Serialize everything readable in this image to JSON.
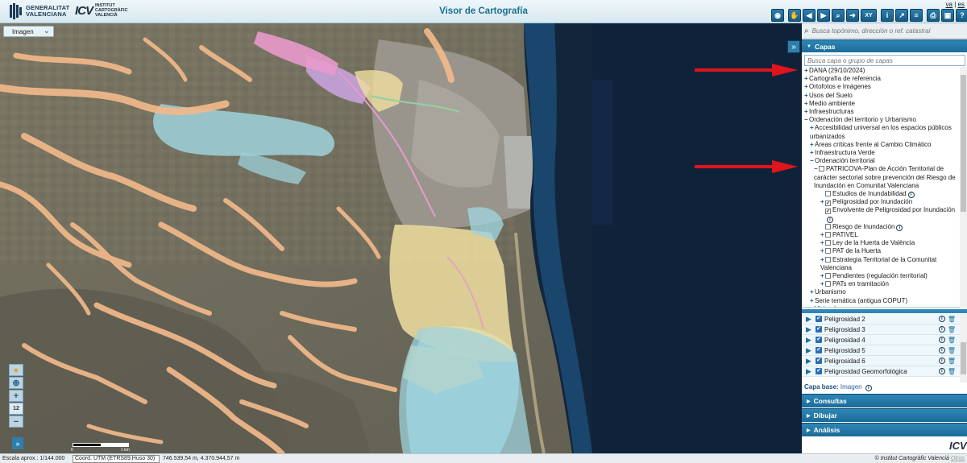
{
  "header": {
    "org1_line1": "GENERALITAT",
    "org1_line2": "VALENCIANA",
    "org2_mark": "ICV",
    "org2_line1": "INSTITUT",
    "org2_line2": "CARTOGRÀFIC",
    "org2_line3": "VALENCIÀ",
    "title": "Visor de Cartografía",
    "lang_va": "va",
    "lang_sep": "|",
    "lang_es": "es"
  },
  "toolbar": {
    "eye": "◉",
    "hand": "✋",
    "prev": "◀",
    "next": "▶",
    "search_map": "⌕",
    "forward": "➜",
    "xy": "XY",
    "info": "i",
    "measure": "↗",
    "layers": "≡",
    "print": "⎙",
    "save": "▣",
    "help": "?"
  },
  "map": {
    "base_select_value": "Imagen",
    "zoom_level": "12",
    "scale_label_left": "0",
    "scale_label_right": "1 km"
  },
  "sidebar": {
    "search_placeholder": "Busca topónimo, dirección o ref. catastral",
    "layers_title": "Capas",
    "layer_search_placeholder": "Busca capa o grupo de capas",
    "tree": [
      {
        "pm": "+",
        "label": "DANA (29/10/2024)",
        "cb": "",
        "info": ""
      },
      {
        "pm": "+",
        "label": "Cartografía de referencia",
        "cb": "",
        "info": ""
      },
      {
        "pm": "+",
        "label": "Ortofotos e Imágenes",
        "cb": "",
        "info": ""
      },
      {
        "pm": "+",
        "label": "Usos del Suelo",
        "cb": "",
        "info": ""
      },
      {
        "pm": "+",
        "label": "Medio ambiente",
        "cb": "",
        "info": ""
      },
      {
        "pm": "+",
        "label": "Infraestructuras",
        "cb": "",
        "info": ""
      },
      {
        "pm": "−",
        "label": "Ordenación del territorio y Urbanismo",
        "cb": "",
        "info": ""
      },
      {
        "pm": "+",
        "label": "Accesibilidad universal en los espacios públicos urbanizados",
        "cb": "",
        "info": ""
      },
      {
        "pm": "+",
        "label": "Áreas críticas frente al Cambio Climático",
        "cb": "",
        "info": ""
      },
      {
        "pm": "+",
        "label": "Infraestructura Verde",
        "cb": "",
        "info": ""
      },
      {
        "pm": "−",
        "label": "Ordenación territorial",
        "cb": "",
        "info": ""
      },
      {
        "pm": "−",
        "label": "PATRICOVA-Plan de Acción Territorial de carácter sectorial sobre prevención del Riesgo de Inundación en Comunitat Valenciana",
        "cb": "empty",
        "info": ""
      },
      {
        "pm": "",
        "label": "Estudios de Inundabilidad",
        "cb": "empty",
        "info": "i"
      },
      {
        "pm": "+",
        "label": "Peligrosidad por Inundación",
        "cb": "checked",
        "info": ""
      },
      {
        "pm": "",
        "label": "Envolvente de Peligrosidad por Inundación",
        "cb": "checked",
        "info": "i"
      },
      {
        "pm": "",
        "label": "Riesgo de Inundación",
        "cb": "empty",
        "info": "i"
      },
      {
        "pm": "+",
        "label": "PATIVEL",
        "cb": "empty",
        "info": ""
      },
      {
        "pm": "+",
        "label": "Ley de la Huerta de València",
        "cb": "empty",
        "info": ""
      },
      {
        "pm": "+",
        "label": "PAT de la Huerta",
        "cb": "empty",
        "info": ""
      },
      {
        "pm": "+",
        "label": "Estrategia Territorial de la Comunitat Valenciana",
        "cb": "empty",
        "info": ""
      },
      {
        "pm": "+",
        "label": "Pendientes (regulación territorial)",
        "cb": "empty",
        "info": ""
      },
      {
        "pm": "+",
        "label": "PATs en tramitación",
        "cb": "empty",
        "info": ""
      },
      {
        "pm": "+",
        "label": "Urbanismo",
        "cb": "",
        "info": ""
      },
      {
        "pm": "+",
        "label": "Serie temática (antigua COPUT)",
        "cb": "",
        "info": ""
      },
      {
        "pm": "+",
        "label": "Vivienda",
        "cb": "",
        "info": ""
      }
    ],
    "active_layers": [
      {
        "name": "Peligrosidad 2"
      },
      {
        "name": "Peligrosidad 3"
      },
      {
        "name": "Peligrosidad 4"
      },
      {
        "name": "Peligrosidad 5"
      },
      {
        "name": "Peligrosidad 6"
      },
      {
        "name": "Peligrosidad Geomorfológica"
      }
    ],
    "base_layer_label": "Capa base:",
    "base_layer_value": "Imagen",
    "sections": {
      "consultas": "Consultas",
      "dibujar": "Dibujar",
      "analisis": "Análisis"
    }
  },
  "footer": {
    "scale": "Escala aprox.: 1/144.000",
    "coord_system": "Coord. UTM (ETRS89,Huso 30)",
    "coords": "746.539,54 m, 4.370.944,57 m",
    "credit": "© Institut Cartogràfic Valencià",
    "credit_link": "Otros"
  },
  "colors": {
    "accent": "#1c6b98",
    "sea": "#13253a",
    "flood_orange": "#f1b98a",
    "flood_yellow": "#f0dfa0",
    "flood_cyan": "#9fd2dc",
    "flood_purple": "#c6a2dc",
    "flood_pink": "#e89acb",
    "annotation_arrow": "#e0141b"
  }
}
